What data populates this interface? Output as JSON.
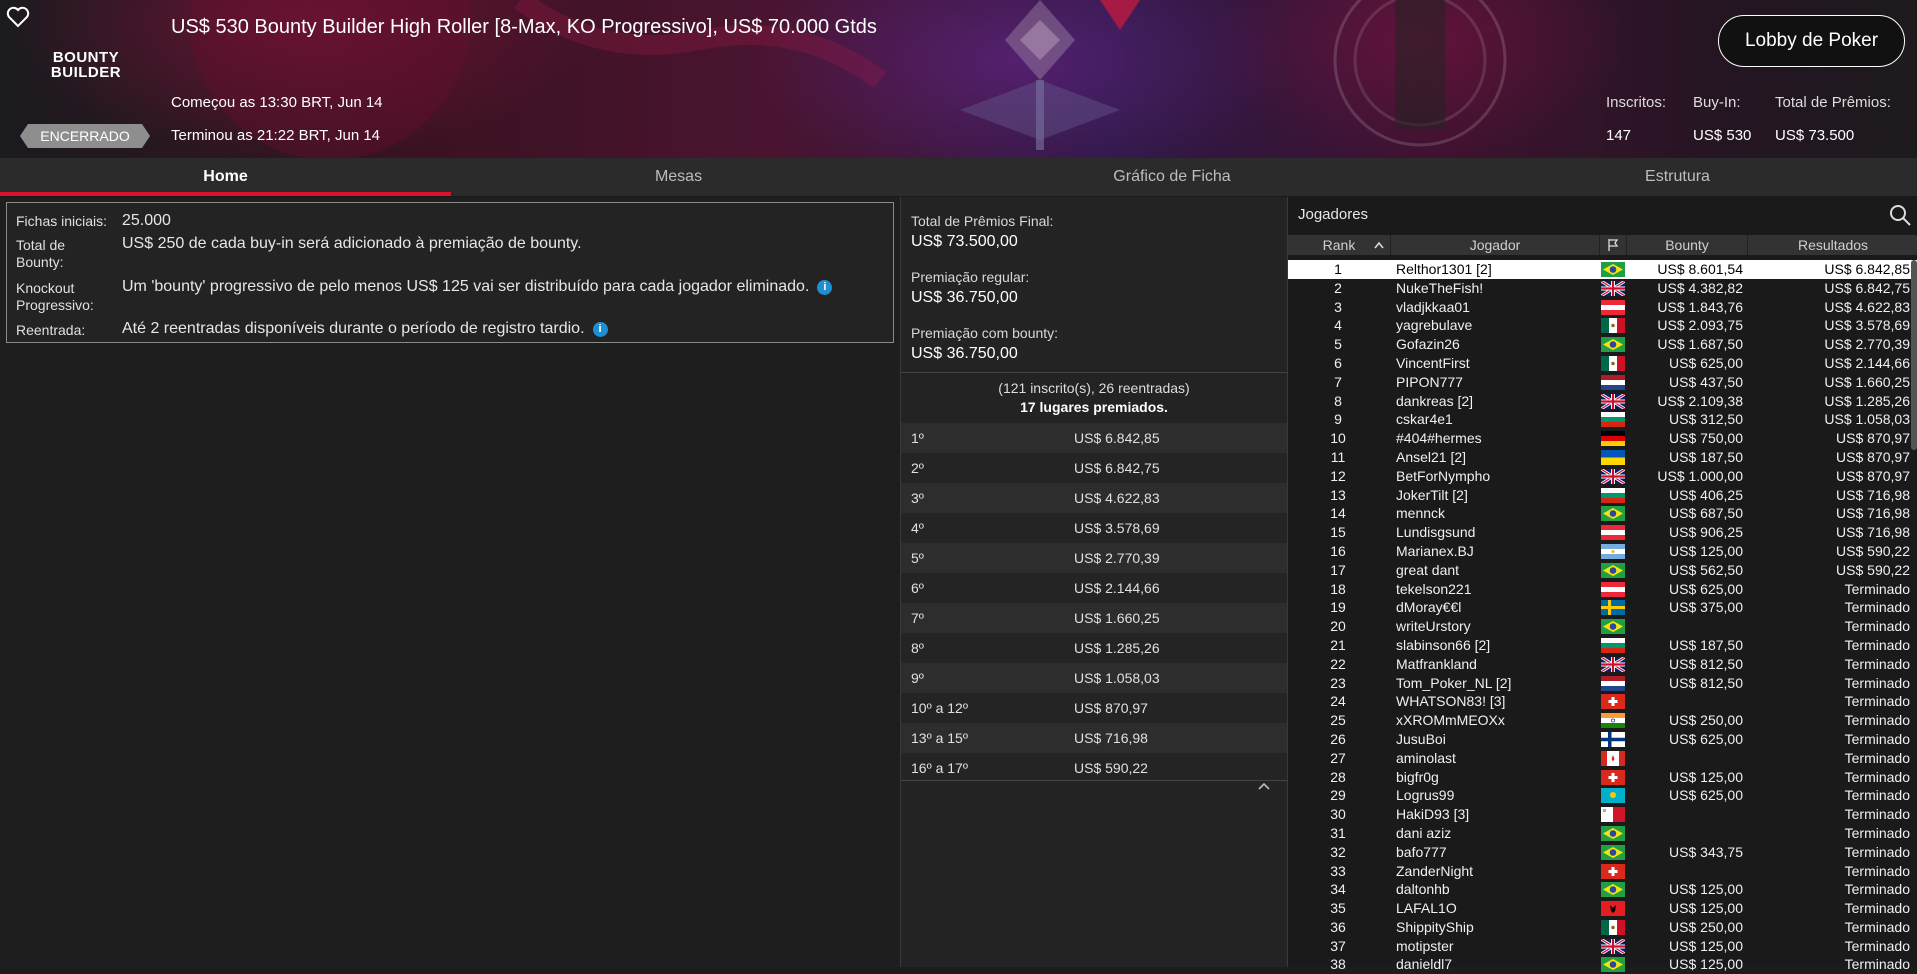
{
  "header": {
    "title": "US$ 530 Bounty Builder High Roller [8-Max, KO Progressivo], US$ 70.000 Gtds",
    "started": "Começou as 13:30 BRT, Jun 14",
    "ended": "Terminou as 21:22 BRT, Jun 14",
    "status_badge": "ENCERRADO",
    "logo_line1": "BOUNTY",
    "logo_line2": "BUILDER",
    "lobby_button": "Lobby de Poker",
    "stats": {
      "entrants_label": "Inscritos:",
      "entrants_value": "147",
      "buyin_label": "Buy-In:",
      "buyin_value": "US$ 530",
      "prize_label": "Total de Prêmios:",
      "prize_value": "US$ 73.500"
    },
    "colors": {
      "accent": "#d8132b",
      "background_start": "#1b1a1f",
      "background_end": "#4a1430"
    }
  },
  "tabs": [
    {
      "label": "Home",
      "active": true
    },
    {
      "label": "Mesas",
      "active": false
    },
    {
      "label": "Gráfico de Ficha",
      "active": false
    },
    {
      "label": "Estrutura",
      "active": false
    }
  ],
  "info": {
    "starting_chips_label": "Fichas iniciais:",
    "starting_chips_value": "25.000",
    "bounty_total_label": "Total de Bounty:",
    "bounty_total_value": "US$ 250 de cada buy-in será adicionado à premiação de bounty.",
    "knockout_label": "Knockout Progressivo:",
    "knockout_value": "Um 'bounty' progressivo de pelo menos US$ 125 vai ser distribuído para cada jogador eliminado.",
    "reentry_label": "Reentrada:",
    "reentry_value": "Até 2 reentradas disponíveis durante o período de registro tardio.",
    "info_icon": "i"
  },
  "prizes": {
    "final_total_label": "Total de Prêmios Final:",
    "final_total_value": "US$ 73.500,00",
    "regular_label": "Premiação regular:",
    "regular_value": "US$ 36.750,00",
    "bounty_label": "Premiação com bounty:",
    "bounty_value": "US$ 36.750,00",
    "entries_text": "(121 inscrito(s), 26 reentradas)",
    "paid_text": "17 lugares premiados.",
    "collapse_icon": "chevron-up-icon",
    "places": [
      {
        "pos": "1º",
        "amount": "US$ 6.842,85"
      },
      {
        "pos": "2º",
        "amount": "US$ 6.842,75"
      },
      {
        "pos": "3º",
        "amount": "US$ 4.622,83"
      },
      {
        "pos": "4º",
        "amount": "US$ 3.578,69"
      },
      {
        "pos": "5º",
        "amount": "US$ 2.770,39"
      },
      {
        "pos": "6º",
        "amount": "US$ 2.144,66"
      },
      {
        "pos": "7º",
        "amount": "US$ 1.660,25"
      },
      {
        "pos": "8º",
        "amount": "US$ 1.285,26"
      },
      {
        "pos": "9º",
        "amount": "US$ 1.058,03"
      },
      {
        "pos": "10º a 12º",
        "amount": "US$ 870,97"
      },
      {
        "pos": "13º a 15º",
        "amount": "US$ 716,98"
      },
      {
        "pos": "16º a 17º",
        "amount": "US$ 590,22"
      }
    ]
  },
  "players": {
    "title": "Jogadores",
    "columns": {
      "rank": "Rank",
      "player": "Jogador",
      "bounty": "Bounty",
      "results": "Resultados"
    },
    "rows": [
      {
        "rank": "1",
        "name": "Relthor1301 [2]",
        "flag": "BR",
        "bounty": "US$ 8.601,54",
        "result": "US$ 6.842,85"
      },
      {
        "rank": "2",
        "name": "NukeTheFish!",
        "flag": "GB",
        "bounty": "US$ 4.382,82",
        "result": "US$ 6.842,75"
      },
      {
        "rank": "3",
        "name": "vladjkkaa01",
        "flag": "AT",
        "bounty": "US$ 1.843,76",
        "result": "US$ 4.622,83"
      },
      {
        "rank": "4",
        "name": "yagrebulave",
        "flag": "MX",
        "bounty": "US$ 2.093,75",
        "result": "US$ 3.578,69"
      },
      {
        "rank": "5",
        "name": "Gofazin26",
        "flag": "BR",
        "bounty": "US$ 1.687,50",
        "result": "US$ 2.770,39"
      },
      {
        "rank": "6",
        "name": "VincentFirst",
        "flag": "MX",
        "bounty": "US$ 625,00",
        "result": "US$ 2.144,66"
      },
      {
        "rank": "7",
        "name": "PIPON777",
        "flag": "NL",
        "bounty": "US$ 437,50",
        "result": "US$ 1.660,25"
      },
      {
        "rank": "8",
        "name": "dankreas [2]",
        "flag": "GB",
        "bounty": "US$ 2.109,38",
        "result": "US$ 1.285,26"
      },
      {
        "rank": "9",
        "name": "cskar4e1",
        "flag": "BG",
        "bounty": "US$ 312,50",
        "result": "US$ 1.058,03"
      },
      {
        "rank": "10",
        "name": "#404#hermes",
        "flag": "DE",
        "bounty": "US$ 750,00",
        "result": "US$ 870,97"
      },
      {
        "rank": "11",
        "name": "Ansel21 [2]",
        "flag": "UA",
        "bounty": "US$ 187,50",
        "result": "US$ 870,97"
      },
      {
        "rank": "12",
        "name": "BetForNympho",
        "flag": "GB",
        "bounty": "US$ 1.000,00",
        "result": "US$ 870,97"
      },
      {
        "rank": "13",
        "name": "JokerTilt [2]",
        "flag": "BG",
        "bounty": "US$ 406,25",
        "result": "US$ 716,98"
      },
      {
        "rank": "14",
        "name": "mennck",
        "flag": "BR",
        "bounty": "US$ 687,50",
        "result": "US$ 716,98"
      },
      {
        "rank": "15",
        "name": "Lundisgsund",
        "flag": "AT",
        "bounty": "US$ 906,25",
        "result": "US$ 716,98"
      },
      {
        "rank": "16",
        "name": "Marianex.BJ",
        "flag": "AR",
        "bounty": "US$ 125,00",
        "result": "US$ 590,22"
      },
      {
        "rank": "17",
        "name": "great dant",
        "flag": "BR",
        "bounty": "US$ 562,50",
        "result": "US$ 590,22"
      },
      {
        "rank": "18",
        "name": "tekelson221",
        "flag": "AT",
        "bounty": "US$ 625,00",
        "result": "Terminado"
      },
      {
        "rank": "19",
        "name": "dMoray€€l",
        "flag": "SE",
        "bounty": "US$ 375,00",
        "result": "Terminado"
      },
      {
        "rank": "20",
        "name": "writeUrstory",
        "flag": "BR",
        "bounty": "",
        "result": "Terminado"
      },
      {
        "rank": "21",
        "name": "slabinson66 [2]",
        "flag": "BG",
        "bounty": "US$ 187,50",
        "result": "Terminado"
      },
      {
        "rank": "22",
        "name": "Matfrankland",
        "flag": "GB",
        "bounty": "US$ 812,50",
        "result": "Terminado"
      },
      {
        "rank": "23",
        "name": "Tom_Poker_NL [2]",
        "flag": "NL",
        "bounty": "US$ 812,50",
        "result": "Terminado"
      },
      {
        "rank": "24",
        "name": "WHATSON83! [3]",
        "flag": "CH",
        "bounty": "",
        "result": "Terminado"
      },
      {
        "rank": "25",
        "name": "xXROMmMEOXx",
        "flag": "IN",
        "bounty": "US$ 250,00",
        "result": "Terminado"
      },
      {
        "rank": "26",
        "name": "JusuBoi",
        "flag": "FI",
        "bounty": "US$ 625,00",
        "result": "Terminado"
      },
      {
        "rank": "27",
        "name": "aminolast",
        "flag": "CA",
        "bounty": "",
        "result": "Terminado"
      },
      {
        "rank": "28",
        "name": "bigfr0g",
        "flag": "CH",
        "bounty": "US$ 125,00",
        "result": "Terminado"
      },
      {
        "rank": "29",
        "name": "Logrus99",
        "flag": "KZ",
        "bounty": "US$ 625,00",
        "result": "Terminado"
      },
      {
        "rank": "30",
        "name": "HakiD93 [3]",
        "flag": "MT",
        "bounty": "",
        "result": "Terminado"
      },
      {
        "rank": "31",
        "name": "dani aziz",
        "flag": "BR",
        "bounty": "",
        "result": "Terminado"
      },
      {
        "rank": "32",
        "name": "bafo777",
        "flag": "BR",
        "bounty": "US$ 343,75",
        "result": "Terminado"
      },
      {
        "rank": "33",
        "name": "ZanderNight",
        "flag": "CH",
        "bounty": "",
        "result": "Terminado"
      },
      {
        "rank": "34",
        "name": "daltonhb",
        "flag": "BR",
        "bounty": "US$ 125,00",
        "result": "Terminado"
      },
      {
        "rank": "35",
        "name": "LAFAL1O",
        "flag": "AL",
        "bounty": "US$ 125,00",
        "result": "Terminado"
      },
      {
        "rank": "36",
        "name": "ShippityShip",
        "flag": "MX",
        "bounty": "US$ 250,00",
        "result": "Terminado"
      },
      {
        "rank": "37",
        "name": "motipster",
        "flag": "GB",
        "bounty": "US$ 125,00",
        "result": "Terminado"
      },
      {
        "rank": "38",
        "name": "danieldl7",
        "flag": "BR",
        "bounty": "US$ 125,00",
        "result": "Terminado"
      }
    ]
  }
}
